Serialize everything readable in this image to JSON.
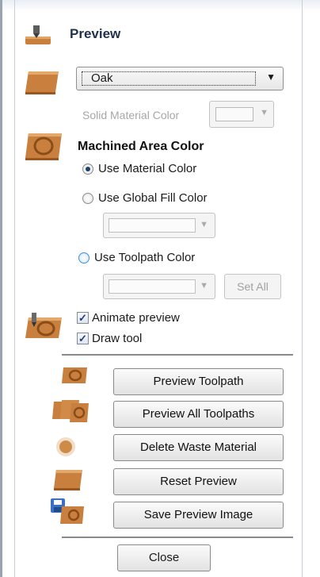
{
  "header": {
    "title": "Preview",
    "icon": "preview-drill-icon"
  },
  "material": {
    "selected": "Oak",
    "solid_label": "Solid Material Color"
  },
  "machined": {
    "title": "Machined Area Color",
    "options": [
      {
        "label": "Use Material Color",
        "checked": true
      },
      {
        "label": "Use Global Fill Color",
        "checked": false
      },
      {
        "label": "Use Toolpath Color",
        "checked": false
      }
    ],
    "set_all_label": "Set All"
  },
  "animate": {
    "animate_label": "Animate preview",
    "draw_tool_label": "Draw tool",
    "animate_checked": true,
    "draw_checked": true
  },
  "actions": {
    "preview_toolpath": "Preview Toolpath",
    "preview_all": "Preview All Toolpaths",
    "delete_waste": "Delete Waste Material",
    "reset_preview": "Reset Preview",
    "save_image": "Save Preview Image"
  },
  "footer": {
    "close_label": "Close"
  },
  "colors": {
    "wood": "#c9803f",
    "wood_dark": "#a45f25",
    "accent_blue": "#1e3f6d"
  }
}
